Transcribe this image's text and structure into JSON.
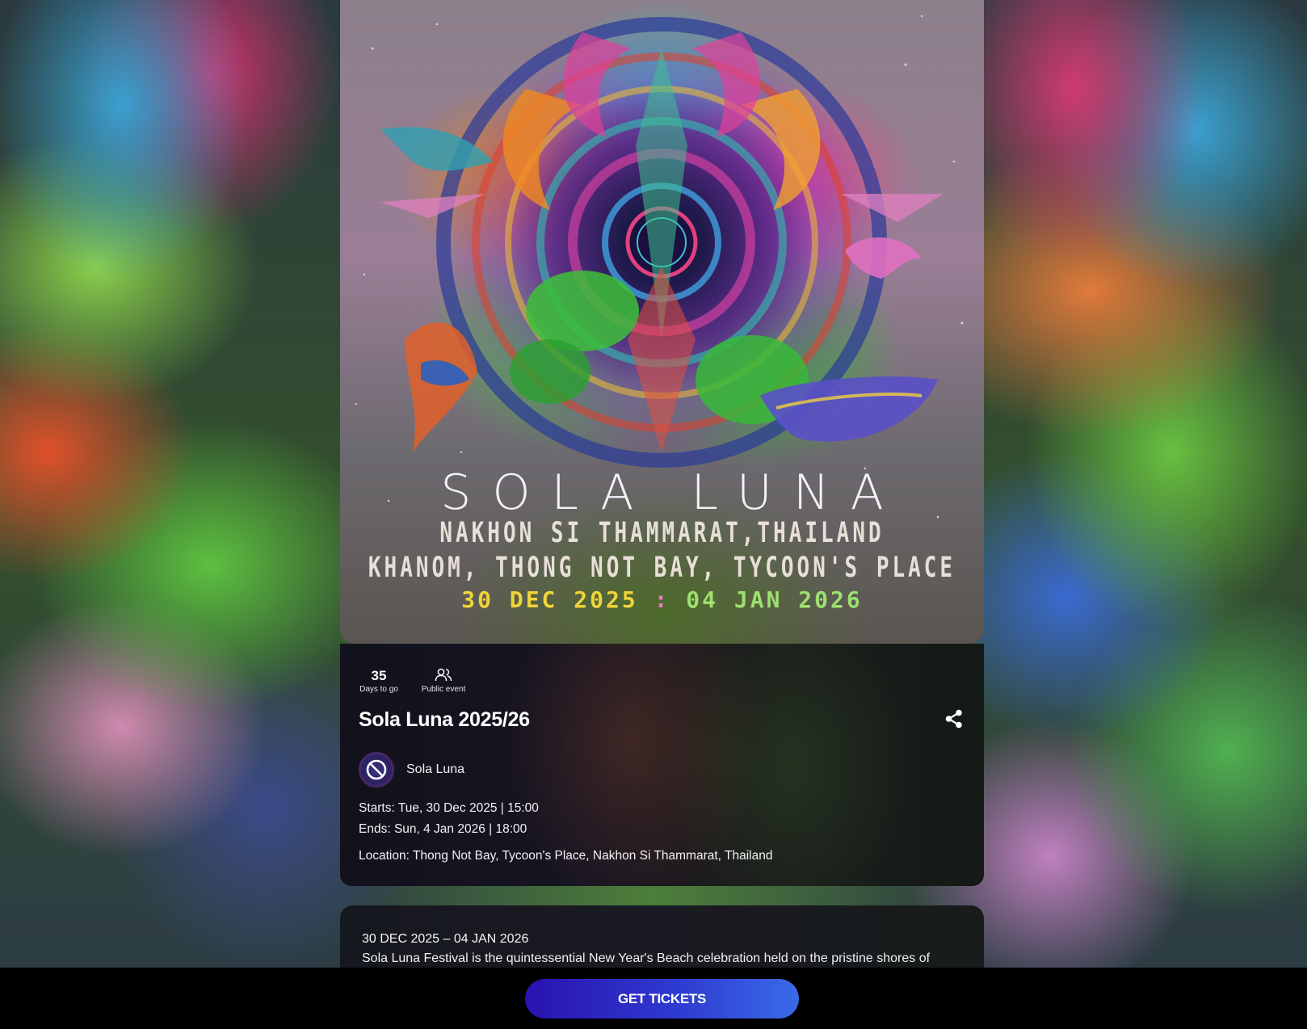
{
  "poster": {
    "title": "SOLA LUNA",
    "line1": "NAKHON SI THAMMARAT,THAILAND",
    "line2": "KHANOM, THONG NOT BAY, TYCOON'S PLACE",
    "dates_start": "30 DEC 2025",
    "dates_sep": ":",
    "dates_end": "04 JAN 2026"
  },
  "stats": {
    "days_value": "35",
    "days_label": "Days to go",
    "public_label": "Public event"
  },
  "event": {
    "title": "Sola Luna 2025/26",
    "organizer": "Sola Luna",
    "starts": "Starts: Tue, 30 Dec 2025 | 15:00",
    "ends": "Ends: Sun, 4 Jan 2026 | 18:00",
    "location": "Location: Thong Not Bay, Tycoon's Place, Nakhon Si Thammarat, Thailand"
  },
  "description": {
    "date_range": "30 DEC 2025 – 04 JAN 2026",
    "text": "Sola Luna Festival is the quintessential New Year's Beach celebration held on the pristine shores of Nakhon"
  },
  "cta": {
    "label": "GET TICKETS"
  },
  "icons": {
    "share": "share-icon",
    "public": "people-icon",
    "avatar_logo": "sola-luna-logo"
  },
  "colors": {
    "cta_start": "#2a12b0",
    "cta_end": "#3a6ae8",
    "date_yellow": "#f0d43a",
    "date_pink": "#f07ab8",
    "date_green": "#9ee070"
  }
}
